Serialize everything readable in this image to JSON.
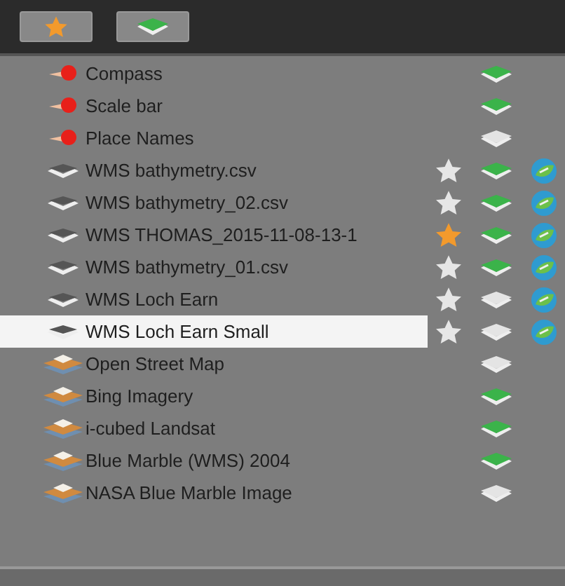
{
  "toolbar": {
    "buttons": [
      {
        "kind": "favorites"
      },
      {
        "kind": "layers"
      }
    ]
  },
  "layers": [
    {
      "kind": "overlay",
      "name": "Compass",
      "visible": true,
      "selected": false
    },
    {
      "kind": "overlay",
      "name": "Scale bar",
      "visible": true,
      "selected": false
    },
    {
      "kind": "overlay",
      "name": "Place Names",
      "visible": false,
      "selected": false
    },
    {
      "kind": "wms",
      "name": "WMS bathymetry.csv",
      "visible": true,
      "favorite": false,
      "selected": false
    },
    {
      "kind": "wms",
      "name": "WMS bathymetry_02.csv",
      "visible": true,
      "favorite": false,
      "selected": false
    },
    {
      "kind": "wms",
      "name": "WMS THOMAS_2015-11-08-13-1",
      "visible": true,
      "favorite": true,
      "selected": false
    },
    {
      "kind": "wms",
      "name": "WMS bathymetry_01.csv",
      "visible": true,
      "favorite": false,
      "selected": false
    },
    {
      "kind": "wms",
      "name": "WMS Loch Earn",
      "visible": false,
      "favorite": false,
      "selected": false
    },
    {
      "kind": "wms",
      "name": "WMS Loch Earn Small",
      "visible": false,
      "favorite": false,
      "selected": true
    },
    {
      "kind": "base",
      "name": "Open Street Map",
      "visible": false,
      "selected": false
    },
    {
      "kind": "base",
      "name": "Bing Imagery",
      "visible": true,
      "selected": false
    },
    {
      "kind": "base",
      "name": "i-cubed Landsat",
      "visible": true,
      "selected": false
    },
    {
      "kind": "base",
      "name": "Blue Marble (WMS) 2004",
      "visible": true,
      "selected": false
    },
    {
      "kind": "base",
      "name": "NASA Blue Marble Image",
      "visible": false,
      "selected": false
    }
  ]
}
